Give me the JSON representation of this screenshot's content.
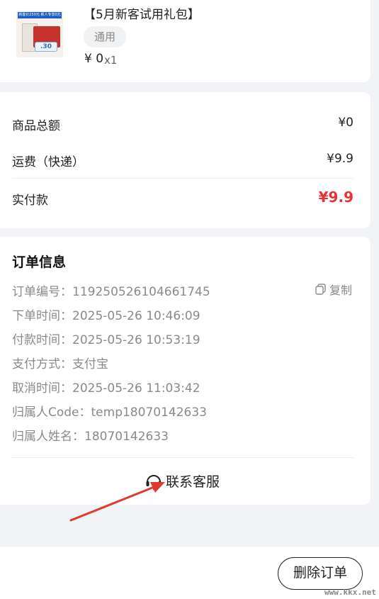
{
  "product": {
    "title": "【5月新客试用礼包】",
    "tag": "通用",
    "price": "¥ 0",
    "qty": "x1",
    "thumb_banner": "新客价250元 新人专享0元",
    "thumb_badge": ".30"
  },
  "summary": {
    "goods_total_label": "商品总额",
    "goods_total_value": "¥0",
    "shipping_label": "运费（快递）",
    "shipping_value": "¥9.9",
    "paid_label": "实付款",
    "paid_value": "¥9.9"
  },
  "order": {
    "heading": "订单信息",
    "copy_label": "复制",
    "rows": [
      "订单编号：119250526104661745",
      "下单时间：2025-05-26 10:46:09",
      "付款时间：2025-05-26 10:53:19",
      "支付方式：支付宝",
      "取消时间：2025-05-26 11:03:42",
      "归属人Code：temp18070142633",
      "归属人姓名：18070142633"
    ],
    "service_label": "联系客服"
  },
  "bottom": {
    "delete_label": "删除订单",
    "watermark": "www.kkx.net"
  },
  "colors": {
    "accent_red": "#e8323a",
    "annotation_arrow": "#e03a2e"
  },
  "icons": {
    "copy": "copy-icon",
    "service": "headset-icon"
  }
}
